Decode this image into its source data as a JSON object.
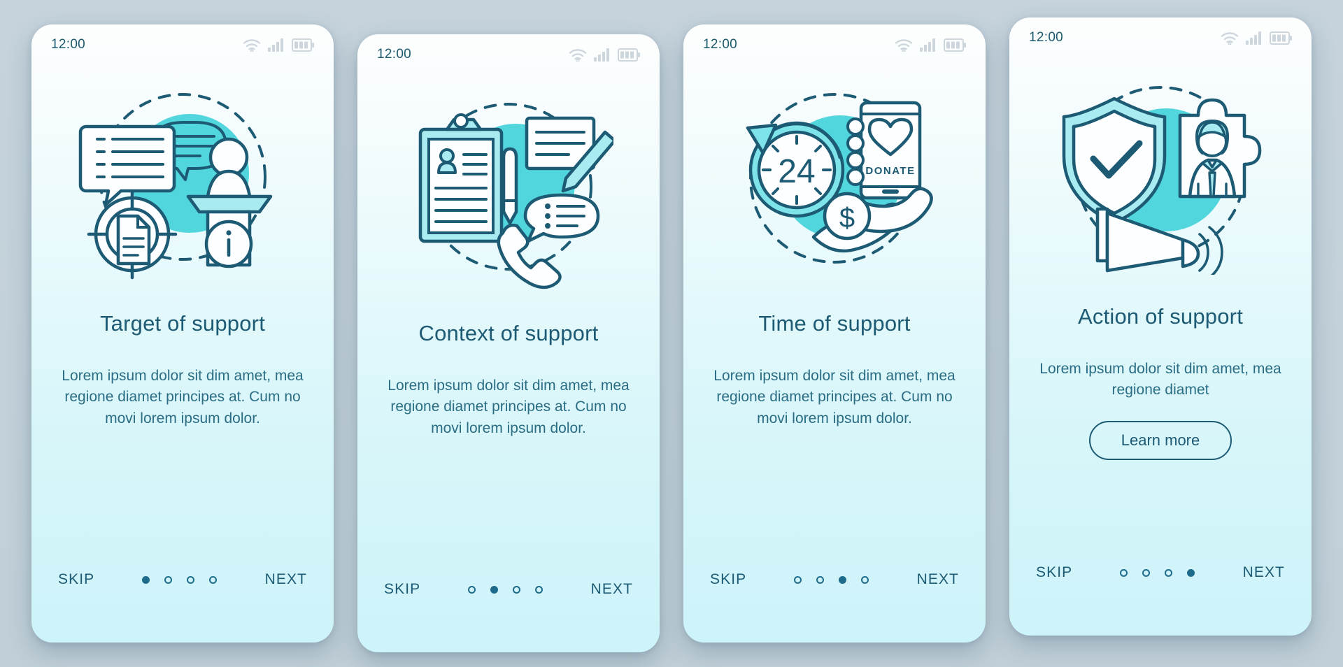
{
  "background_color": "#c3d1da",
  "theme": {
    "ink": "#1d5a74",
    "accent": "#52d6dd",
    "accent_light": "#a8ecf2",
    "card_top": "#fdfefe",
    "card_bottom": "#cdf4f9"
  },
  "screens": [
    {
      "status": {
        "time": "12:00",
        "icons": [
          "wifi-icon",
          "signal-icon",
          "battery-icon"
        ]
      },
      "illustration": "target-of-support-illustration",
      "title": "Target of support",
      "paragraph": "Lorem ipsum dolor sit dim amet, mea regione diamet principes at. Cum no movi lorem ipsum dolor.",
      "button": null,
      "nav": {
        "skip": "SKIP",
        "next": "NEXT",
        "dots": 4,
        "active": 0
      }
    },
    {
      "status": {
        "time": "12:00",
        "icons": [
          "wifi-icon",
          "signal-icon",
          "battery-icon"
        ]
      },
      "illustration": "context-of-support-illustration",
      "title": "Context of support",
      "paragraph": "Lorem ipsum dolor sit dim amet, mea regione diamet principes at. Cum no movi lorem ipsum dolor.",
      "button": null,
      "nav": {
        "skip": "SKIP",
        "next": "NEXT",
        "dots": 4,
        "active": 1
      }
    },
    {
      "status": {
        "time": "12:00",
        "icons": [
          "wifi-icon",
          "signal-icon",
          "battery-icon"
        ]
      },
      "illustration": "time-of-support-illustration",
      "illustration_labels": {
        "clock": "24",
        "phone": "DONATE",
        "coin": "$"
      },
      "title": "Time of support",
      "paragraph": "Lorem ipsum dolor sit dim amet, mea regione diamet principes at. Cum no movi lorem ipsum dolor.",
      "button": null,
      "nav": {
        "skip": "SKIP",
        "next": "NEXT",
        "dots": 4,
        "active": 2
      }
    },
    {
      "status": {
        "time": "12:00",
        "icons": [
          "wifi-icon",
          "signal-icon",
          "battery-icon"
        ]
      },
      "illustration": "action-of-support-illustration",
      "title": "Action of support",
      "paragraph": "Lorem ipsum dolor sit dim amet, mea regione diamet",
      "button": "Learn more",
      "nav": {
        "skip": "SKIP",
        "next": "NEXT",
        "dots": 4,
        "active": 3
      }
    }
  ]
}
